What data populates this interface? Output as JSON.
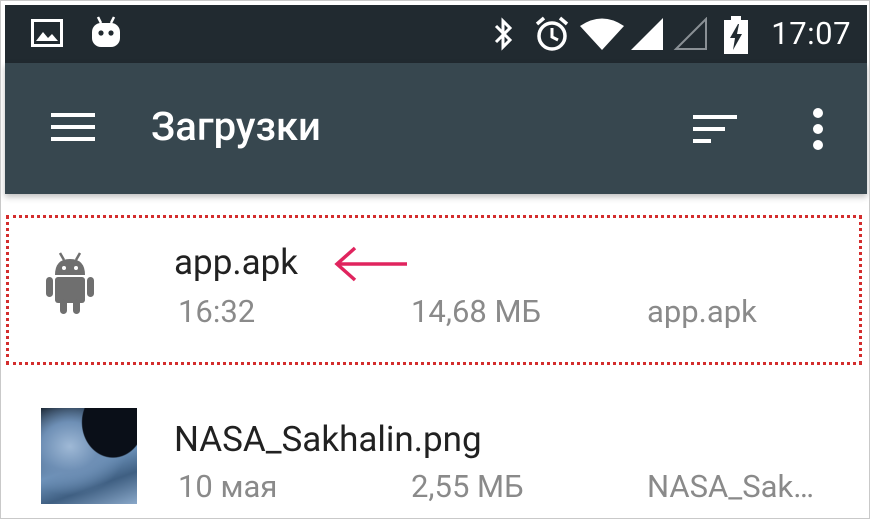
{
  "statusbar": {
    "time": "17:07",
    "icons": [
      "image-icon",
      "android-robot-icon",
      "bluetooth-icon",
      "alarm-icon",
      "wifi-icon",
      "signal-icon",
      "signal-empty-icon",
      "battery-charging-icon"
    ]
  },
  "appbar": {
    "title": "Загрузки",
    "icons": [
      "menu-icon",
      "sort-icon",
      "more-vert-icon"
    ]
  },
  "files": [
    {
      "name": "app.apk",
      "time": "16:32",
      "size": "14,68 МБ",
      "summary": "app.apk",
      "icon": "android-icon",
      "highlighted": true
    },
    {
      "name": "NASA_Sakhalin.png",
      "time": "10 мая",
      "size": "2,55 МБ",
      "summary": "NASA_Sak…",
      "icon": "image-thumbnail"
    }
  ],
  "colors": {
    "statusbar_bg": "#212a30",
    "appbar_bg": "#37474f",
    "highlight_border": "#d32d2d",
    "arrow": "#e0245e",
    "android_icon": "#6f6f6f",
    "meta_text": "#8a8a8a"
  }
}
